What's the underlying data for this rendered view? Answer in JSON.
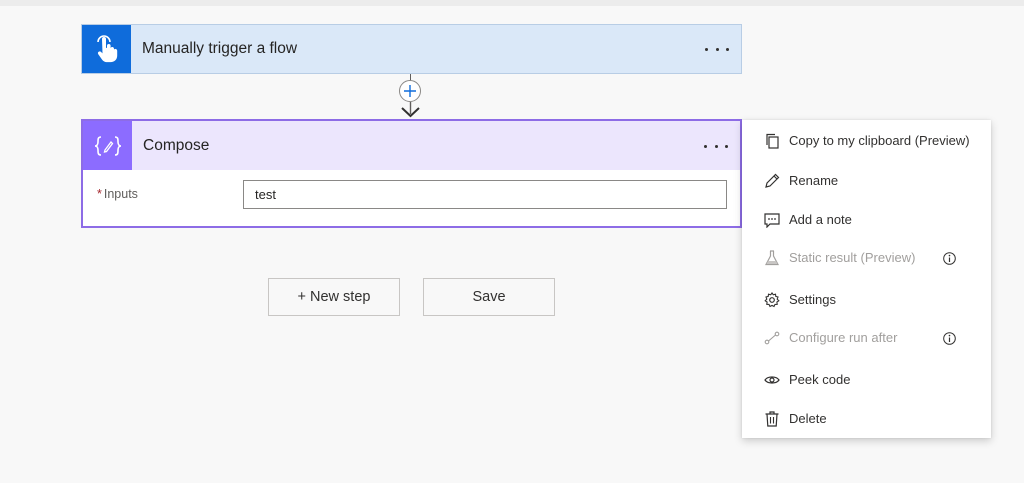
{
  "trigger": {
    "title": "Manually trigger a flow",
    "icon": "touch-hand-icon"
  },
  "compose": {
    "title": "Compose",
    "icon": "braces-pencil-icon",
    "inputs_label": "Inputs",
    "required_marker": "*",
    "inputs_value": "test"
  },
  "buttons": {
    "new_step": "+ New step",
    "save": "Save"
  },
  "menu": {
    "items": [
      {
        "label": "Copy to my clipboard (Preview)",
        "icon": "copy-icon",
        "enabled": true
      },
      {
        "label": "Rename",
        "icon": "pencil-icon",
        "enabled": true
      },
      {
        "label": "Add a note",
        "icon": "comment-icon",
        "enabled": true
      },
      {
        "label": "Static result (Preview)",
        "icon": "flask-icon",
        "enabled": false,
        "info": true
      },
      {
        "label": "Settings",
        "icon": "gear-icon",
        "enabled": true
      },
      {
        "label": "Configure run after",
        "icon": "run-after-icon",
        "enabled": false,
        "info": true
      },
      {
        "label": "Peek code",
        "icon": "eye-icon",
        "enabled": true
      },
      {
        "label": "Delete",
        "icon": "trash-icon",
        "enabled": true
      }
    ]
  },
  "colors": {
    "trigger_accent": "#0f6cdb",
    "trigger_header": "#dae8f8",
    "compose_accent": "#8c6cff",
    "compose_header": "#ece6fd",
    "compose_border": "#8d6ce6"
  }
}
